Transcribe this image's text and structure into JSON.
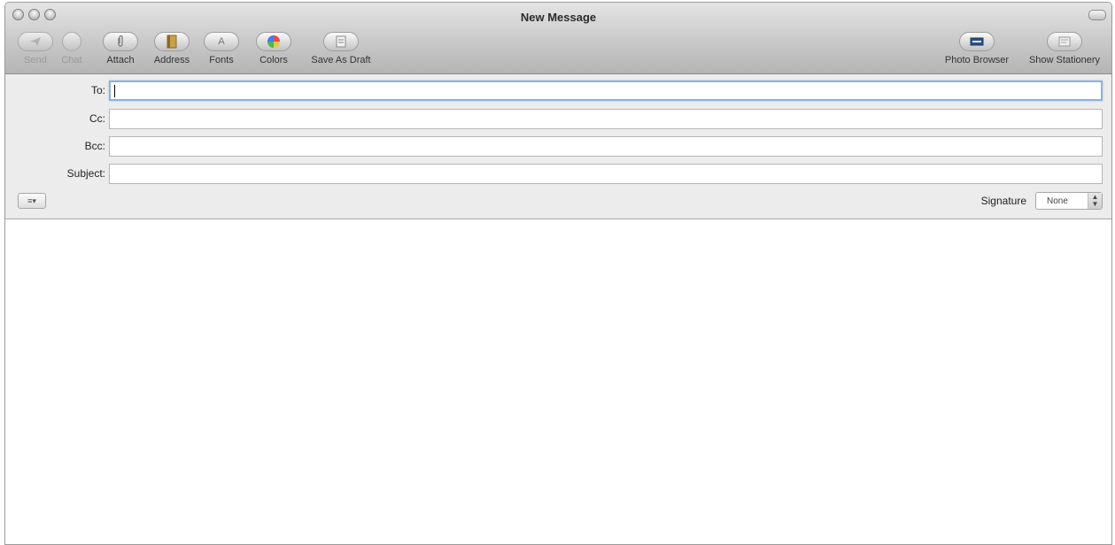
{
  "window": {
    "title": "New Message"
  },
  "toolbar": {
    "send_label": "Send",
    "chat_label": "Chat",
    "attach_label": "Attach",
    "address_label": "Address",
    "fonts_label": "Fonts",
    "colors_label": "Colors",
    "save_as_draft_label": "Save As Draft",
    "photo_browser_label": "Photo Browser",
    "show_stationery_label": "Show Stationery"
  },
  "fields": {
    "to_label": "To:",
    "to_value": "",
    "cc_label": "Cc:",
    "cc_value": "",
    "bcc_label": "Bcc:",
    "bcc_value": "",
    "subject_label": "Subject:",
    "subject_value": ""
  },
  "signature": {
    "label": "Signature",
    "selected": "None"
  },
  "body": {
    "text": ""
  }
}
